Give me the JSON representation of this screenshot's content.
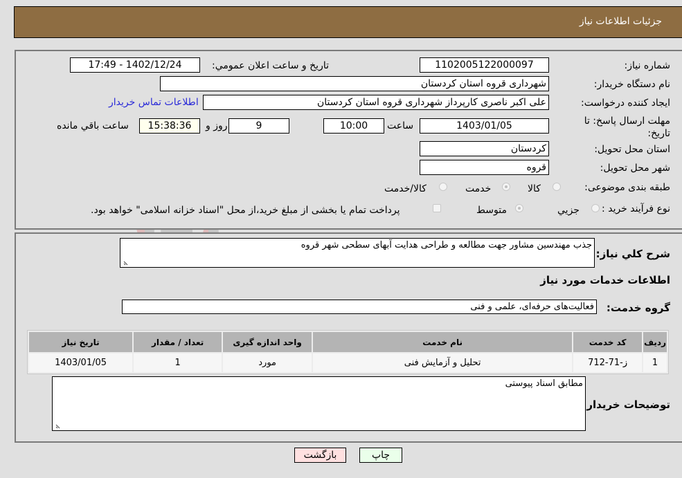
{
  "header": {
    "title": "جزئیات اطلاعات نیاز"
  },
  "form": {
    "need_number": {
      "label": "شماره نیاز:",
      "value": "1102005122000097"
    },
    "announce_datetime": {
      "label": "تاریخ و ساعت اعلان عمومي:",
      "value": "1402/12/24 - 17:49"
    },
    "buyer_org": {
      "label": "نام دستگاه خریدار:",
      "value": "شهرداری قروه استان کردستان"
    },
    "requester": {
      "label": "ایجاد کننده درخواست:",
      "value": "علی اکبر ناصری کارپرداز شهرداری قروه استان کردستان",
      "contact_link": "اطلاعات تماس خریدار"
    },
    "deadline": {
      "label": "مهلت ارسال پاسخ: تا تاریخ:",
      "date": "1403/01/05",
      "time_label": "ساعت",
      "time": "10:00",
      "days": "9",
      "days_label": "روز و",
      "remaining": "15:38:36",
      "remaining_label": "ساعت باقي مانده"
    },
    "delivery_province": {
      "label": "استان محل تحویل:",
      "value": "کردستان"
    },
    "delivery_city": {
      "label": "شهر محل تحویل:",
      "value": "قروه"
    },
    "category": {
      "label": "طبقه بندی موضوعی:",
      "options": [
        "کالا",
        "خدمت",
        "کالا/خدمت"
      ],
      "selected": "خدمت"
    },
    "purchase_type": {
      "label": "نوع فرآیند خرید :",
      "options": [
        "جزيي",
        "متوسط"
      ],
      "selected": "متوسط",
      "treasury_note": "پرداخت تمام یا بخشی از مبلغ خرید،از محل \"اسناد خزانه اسلامی\" خواهد بود."
    }
  },
  "description": {
    "label": "شرح کلي نياز:",
    "value": "جذب مهندسین مشاور جهت مطالعه و طراحی هدایت آبهای سطحی شهر قروه"
  },
  "services": {
    "section_title": "اطلاعات خدمات مورد نياز",
    "group_label": "گروه خدمت:",
    "group_value": "فعالیت‌های حرفه‌ای، علمی و فنی",
    "columns": [
      "ردیف",
      "کد خدمت",
      "نام خدمت",
      "واحد اندازه گیری",
      "تعداد / مقدار",
      "تاریخ نیاز"
    ],
    "rows": [
      [
        "1",
        "ز-71-712",
        "تحلیل و آزمایش فنی",
        "مورد",
        "1",
        "1403/01/05"
      ]
    ]
  },
  "buyer_notes": {
    "label": "توضیحات خریدار:",
    "value": "مطابق اسناد پیوستی"
  },
  "buttons": {
    "print": "چاپ",
    "back": "بازگشت"
  },
  "colors": {
    "header_bg": "#8e6d42",
    "link": "#2a2ad8",
    "print_bg": "#eaffea",
    "back_bg": "#ffe0e0"
  }
}
